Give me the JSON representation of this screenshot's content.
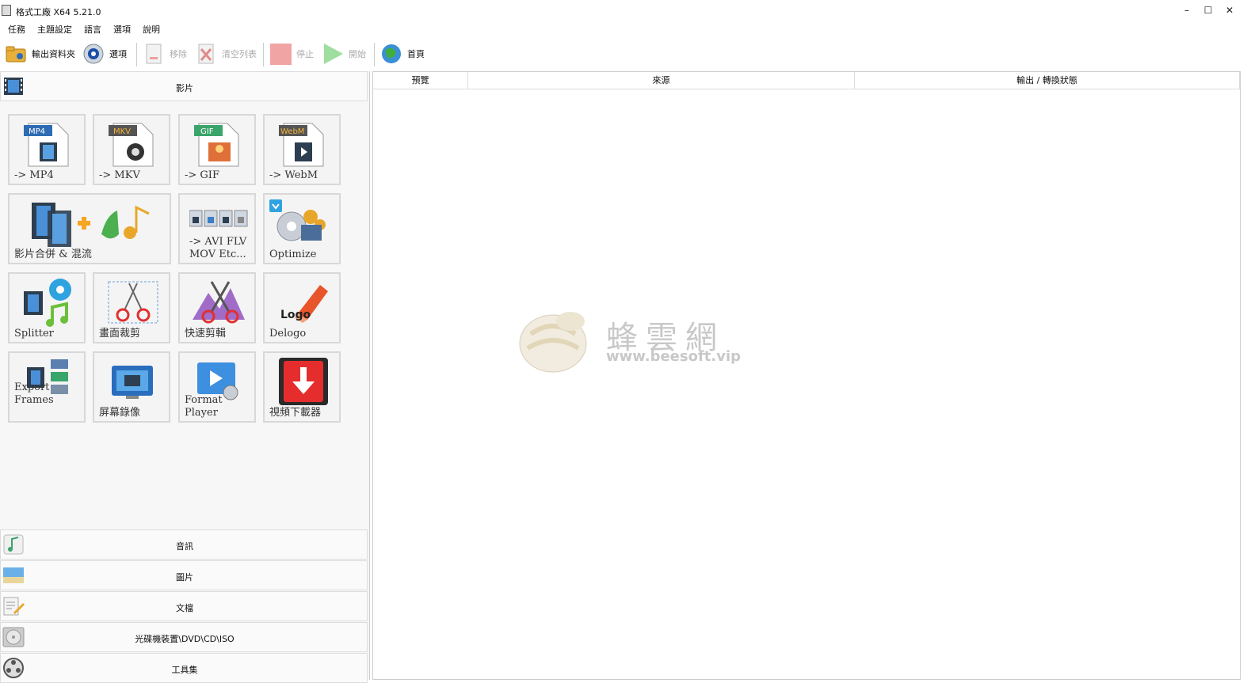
{
  "window": {
    "title": "格式工廠 X64 5.21.0",
    "min": "–",
    "max": "☐",
    "close": "✕"
  },
  "menu": [
    "任務",
    "主題設定",
    "語言",
    "選項",
    "說明"
  ],
  "toolbar": {
    "output_folder": "輸出資料夾",
    "options": "選項",
    "remove": "移除",
    "clear_list": "清空列表",
    "stop": "停止",
    "start": "開始",
    "home": "首頁"
  },
  "categories": {
    "video": "影片",
    "audio": "音訊",
    "picture": "圖片",
    "document": "文檔",
    "rom": "光碟機裝置\\DVD\\CD\\ISO",
    "tools": "工具集"
  },
  "tiles": {
    "mp4": {
      "badge": "MP4",
      "label": "-> MP4"
    },
    "mkv": {
      "badge": "MKV",
      "label": "-> MKV"
    },
    "gif": {
      "badge": "GIF",
      "label": "-> GIF"
    },
    "webm": {
      "badge": "WebM",
      "label": "-> WebM"
    },
    "joiner": {
      "label": "影片合併 & 混流"
    },
    "other": {
      "line1": "-> AVI FLV",
      "line2": "MOV Etc..."
    },
    "optimize": {
      "label": "Optimize"
    },
    "splitter": {
      "label": "Splitter"
    },
    "crop": {
      "label": "畫面裁剪"
    },
    "quickclip": {
      "label": "快速剪輯"
    },
    "delogo": {
      "label": "Delogo",
      "logo_text": "Logo"
    },
    "export_frames": {
      "label": "Export Frames"
    },
    "screen_record": {
      "label": "屏幕錄像"
    },
    "player": {
      "label": "Format Player"
    },
    "downloader": {
      "label": "視頻下載器"
    }
  },
  "columns": [
    "預覽",
    "來源",
    "輸出 / 轉換狀態"
  ],
  "watermark": {
    "text": "蜂雲網",
    "url": "www.beesoft.vip"
  }
}
